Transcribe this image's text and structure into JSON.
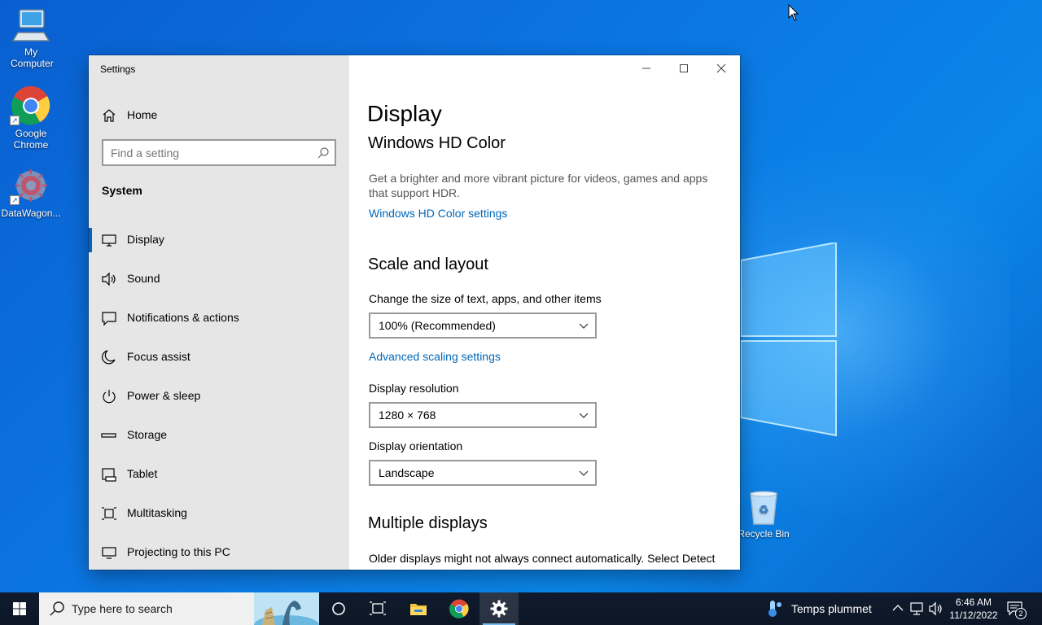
{
  "desktop": {
    "icons": [
      {
        "label": "My\nComputer",
        "name": "my-computer"
      },
      {
        "label": "Google\nChrome",
        "name": "google-chrome"
      },
      {
        "label": "DataWagon...",
        "name": "datawagon"
      },
      {
        "label": "Recycle Bin",
        "name": "recycle-bin"
      }
    ],
    "my_computer_label": "My Computer",
    "chrome_label": "Google Chrome",
    "datawagon_label": "DataWagon...",
    "recycle_bin_label": "Recycle Bin"
  },
  "window": {
    "title": "Settings",
    "controls": {
      "minimize": "minimize-icon",
      "maximize": "maximize-icon",
      "close": "close-icon"
    }
  },
  "sidebar": {
    "home_label": "Home",
    "search_placeholder": "Find a setting",
    "section": "System",
    "items": [
      {
        "label": "Display",
        "icon": "monitor-icon",
        "active": true
      },
      {
        "label": "Sound",
        "icon": "speaker-icon"
      },
      {
        "label": "Notifications & actions",
        "icon": "notification-icon"
      },
      {
        "label": "Focus assist",
        "icon": "moon-icon"
      },
      {
        "label": "Power & sleep",
        "icon": "power-icon"
      },
      {
        "label": "Storage",
        "icon": "storage-icon"
      },
      {
        "label": "Tablet",
        "icon": "tablet-icon"
      },
      {
        "label": "Multitasking",
        "icon": "multitasking-icon"
      },
      {
        "label": "Projecting to this PC",
        "icon": "projecting-icon"
      }
    ]
  },
  "content": {
    "page_title": "Display",
    "hdr": {
      "heading": "Windows HD Color",
      "description": "Get a brighter and more vibrant picture for videos, games and apps that support HDR.",
      "link": "Windows HD Color settings"
    },
    "scale": {
      "heading": "Scale and layout",
      "size_label": "Change the size of text, apps, and other items",
      "size_value": "100% (Recommended)",
      "advanced_link": "Advanced scaling settings",
      "resolution_label": "Display resolution",
      "resolution_value": "1280 × 768",
      "orientation_label": "Display orientation",
      "orientation_value": "Landscape"
    },
    "multi": {
      "heading": "Multiple displays",
      "description": "Older displays might not always connect automatically. Select Detect"
    }
  },
  "taskbar": {
    "search_placeholder": "Type here to search",
    "weather_text": "Temps plummet",
    "time": "6:46 AM",
    "date": "11/12/2022",
    "notification_count": "2"
  },
  "colors": {
    "accent": "#0067c0",
    "link": "#0067b8",
    "sidebar_bg": "#e6e6e6",
    "taskbar_bg": "#0f1b2d"
  }
}
